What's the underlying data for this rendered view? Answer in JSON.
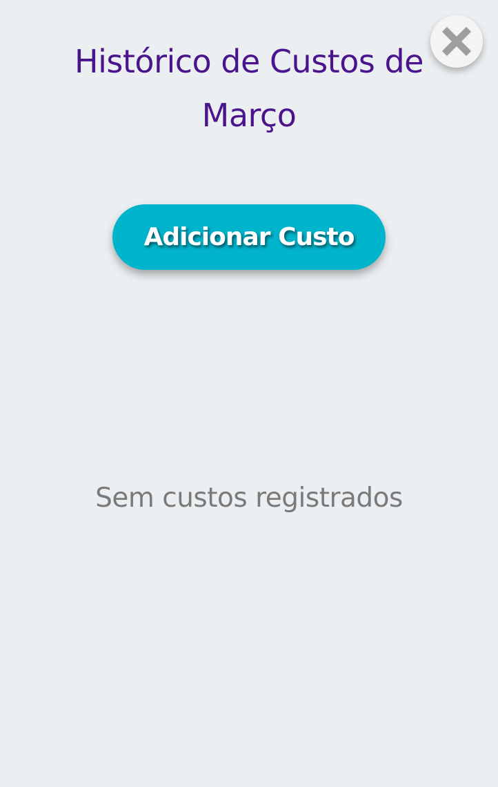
{
  "modal": {
    "title": "Histórico de Custos de Março",
    "close_icon": "close-icon",
    "add_button_label": "Adicionar Custo",
    "empty_message": "Sem custos registrados"
  },
  "colors": {
    "background": "#eceff1",
    "title": "#4a148c",
    "accent": "#00b4cc",
    "empty_text": "#7a7a7a",
    "close_background": "#f4f4f4",
    "close_icon": "#9e9e9e"
  }
}
